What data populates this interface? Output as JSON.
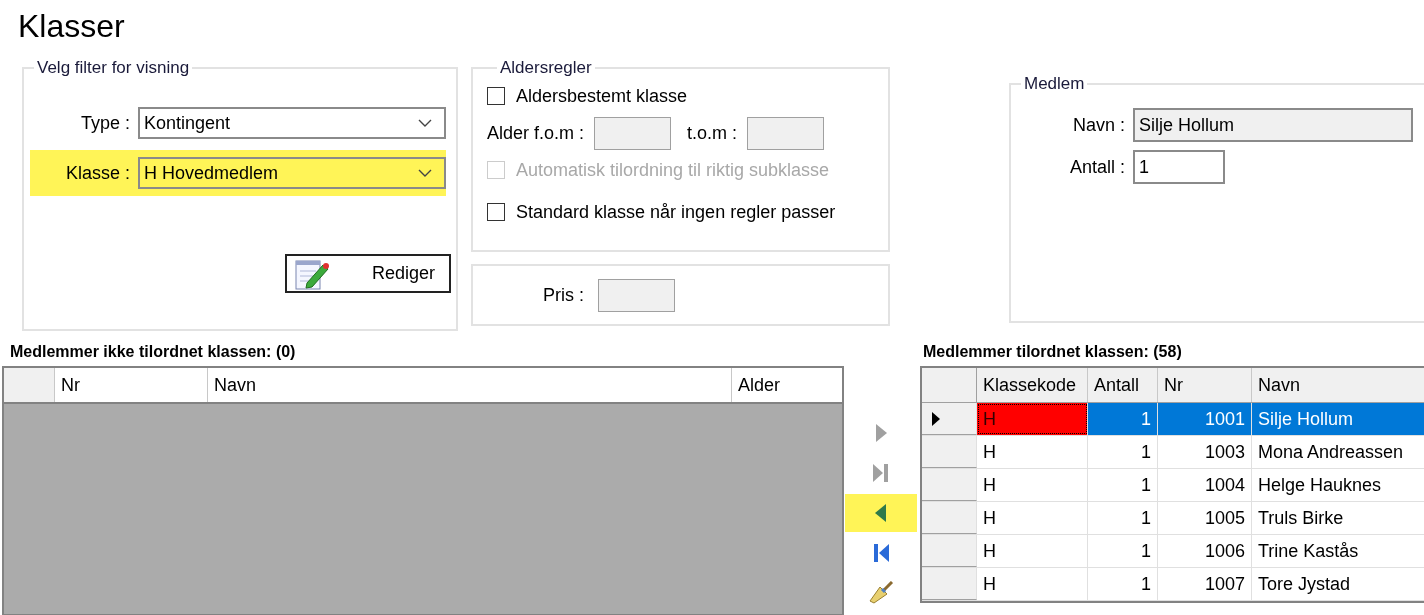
{
  "title": "Klasser",
  "filter_group": {
    "title": "Velg  filter for visning",
    "type": {
      "label": "Type :",
      "value": "Kontingent",
      "highlighted": false
    },
    "klasse": {
      "label": "Klasse :",
      "value": "H Hovedmedlem",
      "highlighted": true
    },
    "edit_button": "Rediger"
  },
  "age_rules": {
    "title": "Aldersregler",
    "age_determined": {
      "label": "Aldersbestemt klasse",
      "checked": false,
      "disabled": false
    },
    "age_from": {
      "label": "Alder f.o.m :"
    },
    "age_to": {
      "label": "t.o.m :"
    },
    "auto_assign": {
      "label": "Automatisk tilordning til riktig subklasse",
      "checked": false,
      "disabled": true
    },
    "default_class": {
      "label": "Standard klasse når ingen regler passer",
      "checked": false,
      "disabled": false
    }
  },
  "price": {
    "label": "Pris :"
  },
  "member": {
    "title": "Medlem",
    "name": {
      "label": "Navn :",
      "value": "Silje Hollum"
    },
    "count": {
      "label": "Antall :",
      "value": "1"
    }
  },
  "unassigned": {
    "title": "Medlemmer ikke tilordnet klassen: (0)",
    "columns": [
      "Nr",
      "Navn",
      "Alder"
    ]
  },
  "transfer_buttons": [
    {
      "kind": "move-right",
      "disabled": true,
      "highlighted": false
    },
    {
      "kind": "move-all-right",
      "disabled": true,
      "highlighted": false
    },
    {
      "kind": "move-left",
      "disabled": false,
      "highlighted": true
    },
    {
      "kind": "move-all-left",
      "disabled": false,
      "highlighted": false
    },
    {
      "kind": "clear",
      "disabled": false,
      "highlighted": false
    }
  ],
  "assigned": {
    "title": "Medlemmer tilordnet klassen: (58)",
    "columns": [
      "Klassekode",
      "Antall",
      "Nr",
      "Navn"
    ],
    "rows": [
      {
        "code": "H",
        "count": "1",
        "nr": "1001",
        "name": "Silje Hollum",
        "selected": true,
        "flagged": true
      },
      {
        "code": "H",
        "count": "1",
        "nr": "1003",
        "name": "Mona Andreassen",
        "selected": false,
        "flagged": false
      },
      {
        "code": "H",
        "count": "1",
        "nr": "1004",
        "name": "Helge Hauknes",
        "selected": false,
        "flagged": false
      },
      {
        "code": "H",
        "count": "1",
        "nr": "1005",
        "name": "Truls Birke",
        "selected": false,
        "flagged": false
      },
      {
        "code": "H",
        "count": "1",
        "nr": "1006",
        "name": "Trine Kastås",
        "selected": false,
        "flagged": false
      },
      {
        "code": "H",
        "count": "1",
        "nr": "1007",
        "name": "Tore Jystad",
        "selected": false,
        "flagged": false
      }
    ]
  }
}
